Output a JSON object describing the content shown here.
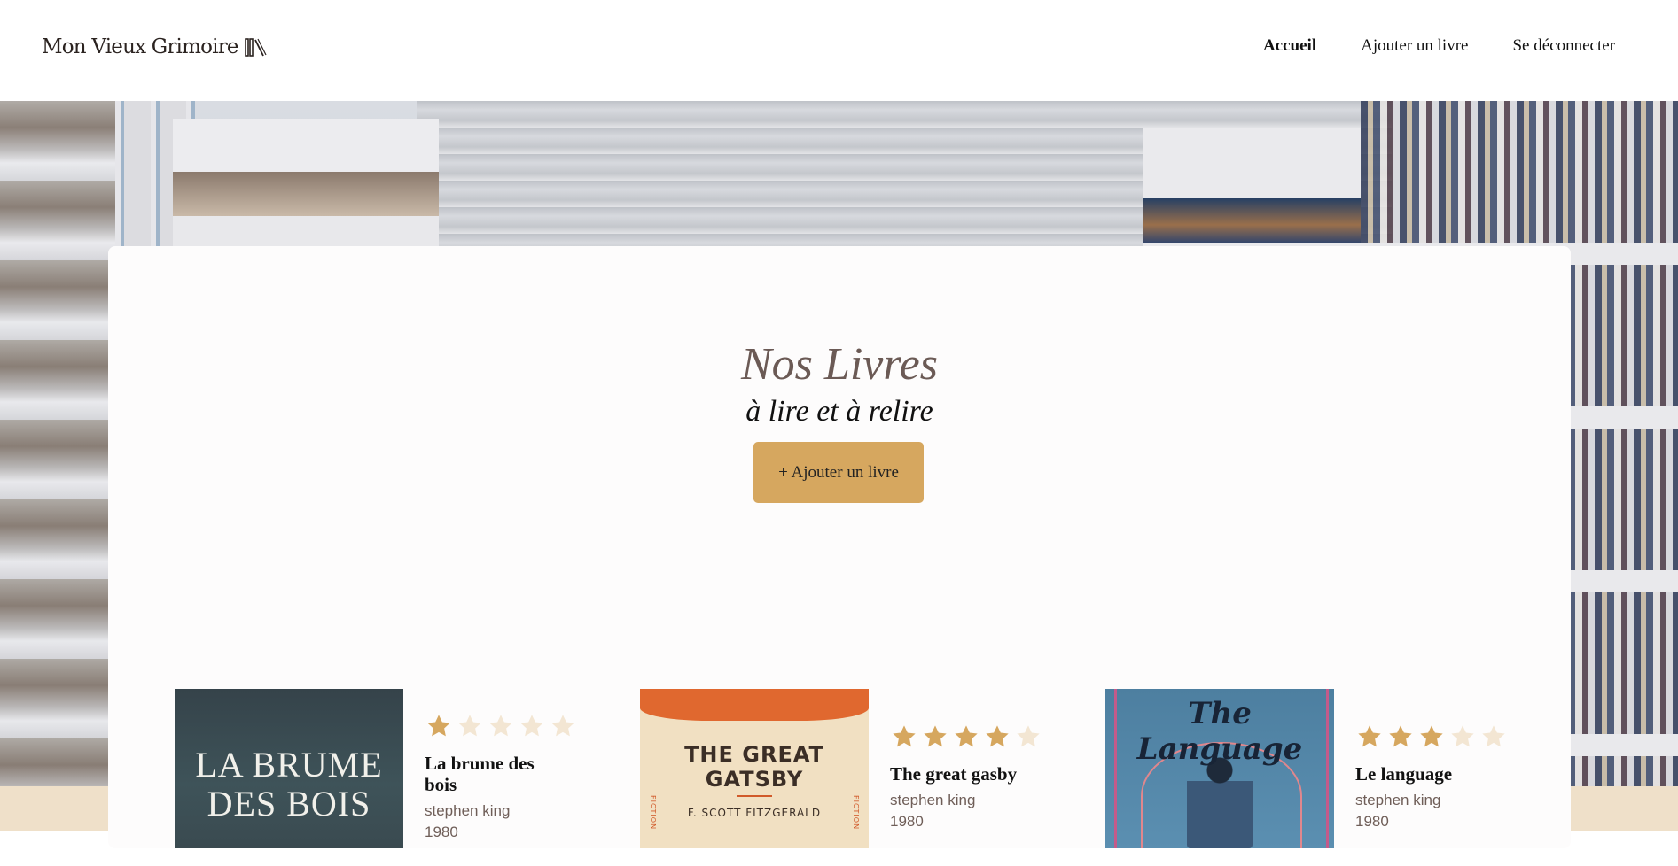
{
  "header": {
    "logo_text": "Mon Vieux Grimoire",
    "nav": [
      {
        "label": "Accueil",
        "active": true
      },
      {
        "label": "Ajouter un livre",
        "active": false
      },
      {
        "label": "Se déconnecter",
        "active": false
      }
    ]
  },
  "main": {
    "title": "Nos Livres",
    "subtitle": "à lire et à relire",
    "add_button": "+ Ajouter un livre"
  },
  "colors": {
    "accent": "#d6a75f",
    "star_filled": "#d6a75f",
    "star_empty": "#f3e6d3",
    "title_color": "#6b5a55"
  },
  "books": [
    {
      "title": "La brume des bois",
      "author": "stephen king",
      "year": "1980",
      "rating": 1,
      "cover_text": "LA BRUME DES BOIS"
    },
    {
      "title": "The great gasby",
      "author": "stephen king",
      "year": "1980",
      "rating": 4,
      "cover_text": "THE GREAT GATSBY",
      "cover_author": "F. SCOTT FITZGERALD",
      "cover_side": "FICTION"
    },
    {
      "title": "Le language",
      "author": "stephen king",
      "year": "1980",
      "rating": 3,
      "cover_text": "The Language"
    }
  ]
}
